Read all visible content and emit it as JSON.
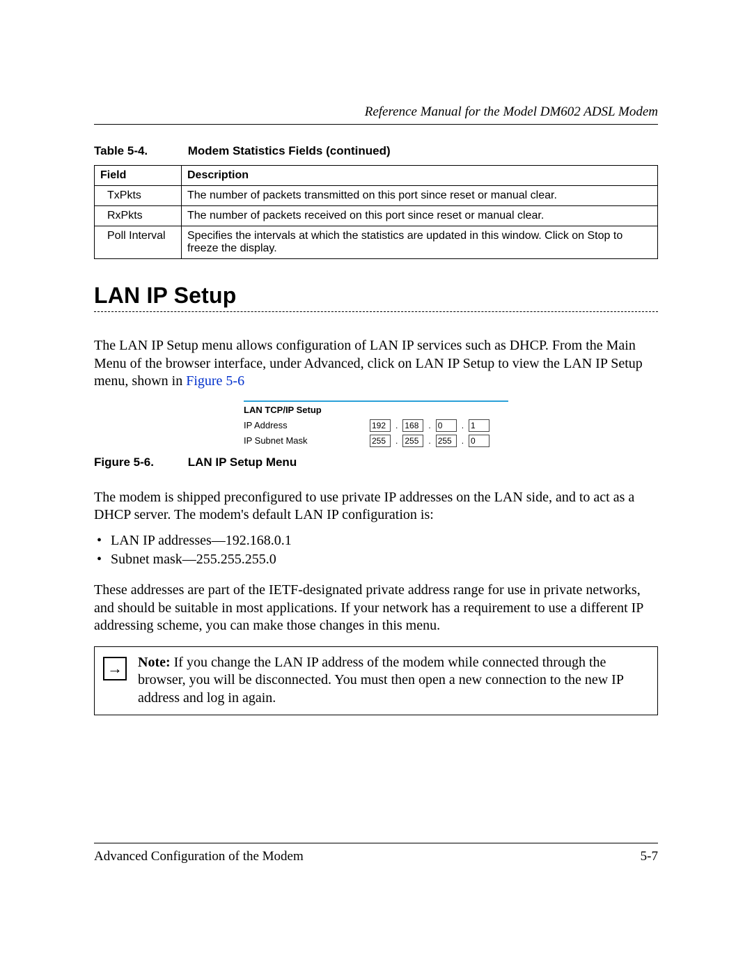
{
  "header": {
    "running": "Reference Manual for the Model DM602 ADSL Modem"
  },
  "table": {
    "caption_label": "Table 5-4.",
    "caption_text": "Modem Statistics Fields (continued)",
    "head": {
      "c1": "Field",
      "c2": "Description"
    },
    "rows": [
      {
        "f": "TxPkts",
        "d": "The number of packets transmitted on this port since reset or manual clear."
      },
      {
        "f": "RxPkts",
        "d": "The number of packets received on this port since reset or manual clear."
      },
      {
        "f": "Poll Interval",
        "d": "Specifies the intervals at which the statistics are updated in this window. Click on Stop to freeze the display."
      }
    ]
  },
  "section_title": "LAN IP Setup",
  "para1_a": "The LAN IP Setup menu allows configuration of LAN IP services such as DHCP. From the Main Menu of the browser interface, under Advanced, click on LAN IP Setup to view the LAN IP Setup menu, shown in ",
  "para1_link": "Figure 5-6",
  "figure": {
    "panel_title": "LAN TCP/IP Setup",
    "ip_label": "IP Address",
    "mask_label": "IP Subnet Mask",
    "ip": [
      "192",
      "168",
      "0",
      "1"
    ],
    "mask": [
      "255",
      "255",
      "255",
      "0"
    ],
    "caption_label": "Figure 5-6.",
    "caption_text": "LAN IP Setup Menu"
  },
  "para2": "The modem is shipped preconfigured to use private IP addresses on the LAN side, and to act as a DHCP server. The modem's default LAN IP configuration is:",
  "bullets": [
    "LAN IP addresses—192.168.0.1",
    "Subnet mask—255.255.255.0"
  ],
  "para3": "These addresses are part of the IETF-designated private address range for use in private networks, and should be suitable in most applications. If your network has a requirement to use a different IP addressing scheme, you can make those changes in this menu.",
  "note": {
    "label": "Note:",
    "text": " If you change the LAN IP address of the modem while connected through the browser, you will be disconnected. You must then open a new connection to the new IP address and log in again."
  },
  "footer": {
    "left": "Advanced Configuration of the Modem",
    "right": "5-7"
  }
}
